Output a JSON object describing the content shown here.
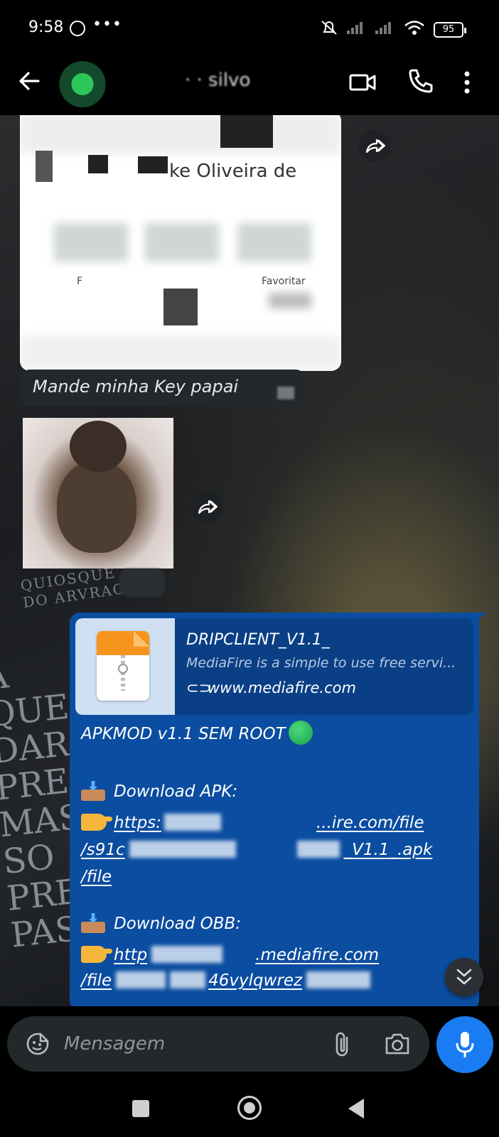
{
  "status_bar": {
    "time": "9:58",
    "dots": "•••",
    "battery": "95"
  },
  "header": {
    "contact_name": "· · silvo"
  },
  "messages": {
    "image_text_name": "ke Oliveira de",
    "image_text_fav": "Favoritar",
    "image_text_f": "F",
    "text": "Mande minha Key papai",
    "link": {
      "preview_title": "DRIPCLIENT_V1.1_",
      "preview_desc": "MediaFire is a simple to use free servi...",
      "preview_url": "www.mediafire.com",
      "line1": "APKMOD v1.1 SEM ROOT",
      "line2": "Download APK:",
      "line3a": "https:",
      "line3b": "...ire.com/file",
      "line4a": "/s91c",
      "line4b": "_V1.1_.apk",
      "line5": "/file",
      "line6": "Download OBB:",
      "line7a": "http",
      "line7b": ".mediafire.com",
      "line8a": "/file",
      "line8b": "46vylqwrez"
    }
  },
  "input": {
    "placeholder": "Mensagem"
  },
  "colors": {
    "outgoing_bubble": "#0b4da0",
    "incoming_bubble": "#23282b",
    "accent": "#1a7cf2"
  }
}
